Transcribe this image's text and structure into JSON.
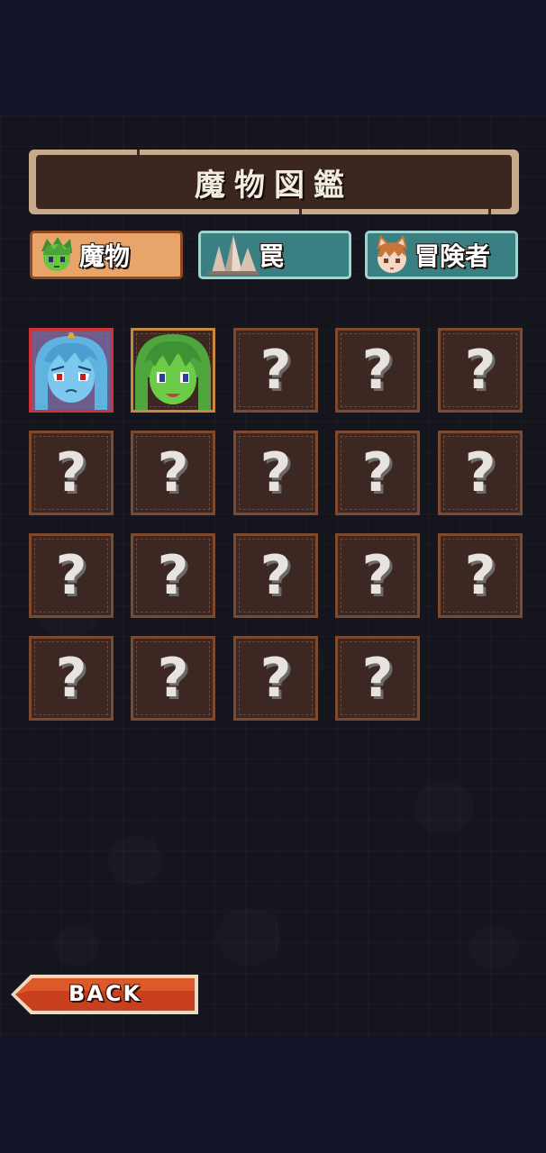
{
  "screen": {
    "title": "魔物図鑑"
  },
  "tabs": [
    {
      "label": "魔物",
      "icon": "green-monster-face-icon",
      "selected": true,
      "color": "#e9a46a"
    },
    {
      "label": "罠",
      "icon": "spike-trap-icon",
      "selected": false,
      "color": "#3a7f82"
    },
    {
      "label": "冒険者",
      "icon": "fox-girl-face-icon",
      "selected": false,
      "color": "#3a7f82"
    }
  ],
  "grid": {
    "unknown_symbol": "?",
    "cells": [
      {
        "state": "unlocked",
        "portrait": "blue-monster-girl-portrait",
        "border_color": "#d03238"
      },
      {
        "state": "unlocked",
        "portrait": "green-monster-girl-portrait",
        "border_color": "#c7893f"
      },
      {
        "state": "locked"
      },
      {
        "state": "locked"
      },
      {
        "state": "locked"
      },
      {
        "state": "locked"
      },
      {
        "state": "locked"
      },
      {
        "state": "locked"
      },
      {
        "state": "locked"
      },
      {
        "state": "locked"
      },
      {
        "state": "locked"
      },
      {
        "state": "locked"
      },
      {
        "state": "locked"
      },
      {
        "state": "locked"
      },
      {
        "state": "locked"
      },
      {
        "state": "locked"
      },
      {
        "state": "locked"
      },
      {
        "state": "locked"
      },
      {
        "state": "locked"
      }
    ]
  },
  "back_button": {
    "label": "BACK",
    "icon": "left-arrow-banner-icon",
    "color": "#c8401e"
  }
}
